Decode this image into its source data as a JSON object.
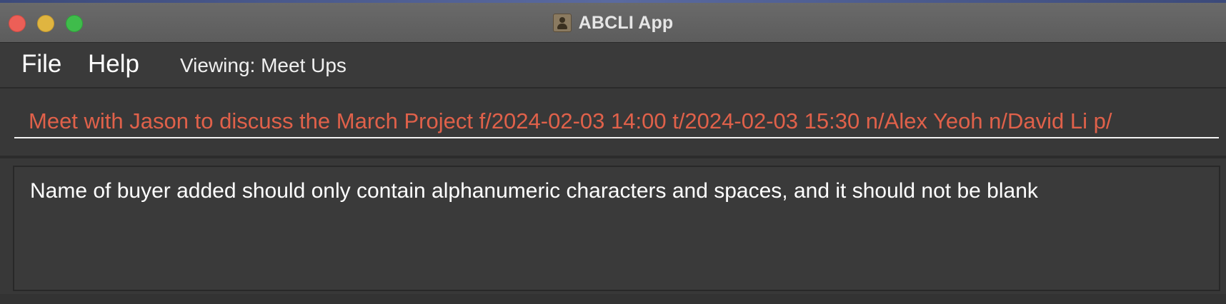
{
  "window": {
    "title": "ABCLI App",
    "controls": [
      "close",
      "minimize",
      "zoom"
    ],
    "app_icon": "contact-book-icon"
  },
  "menubar": {
    "file_label": "File",
    "help_label": "Help",
    "viewing_text": "Viewing: Meet Ups"
  },
  "command": {
    "value": "Meet with Jason to discuss the March Project f/2024-02-03 14:00 t/2024-02-03 15:30 n/Alex Yeoh n/David Li p/",
    "text_color": "#e0614a"
  },
  "result": {
    "message": "Name of buyer added should only contain alphanumeric characters and spaces, and it should not be blank"
  },
  "colors": {
    "background": "#383838",
    "close": "#ec5f57",
    "minimize": "#e0b540",
    "zoom": "#3fbc4b"
  }
}
